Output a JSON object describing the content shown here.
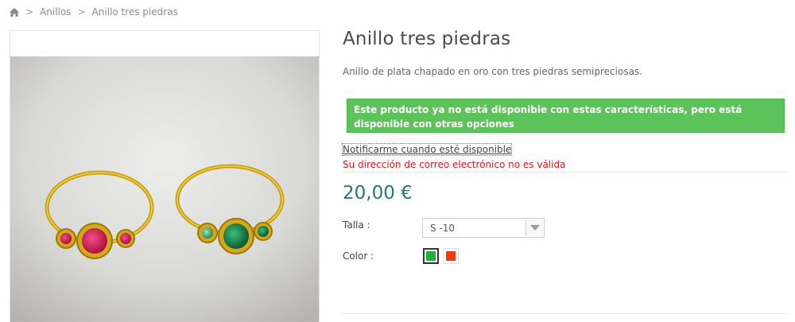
{
  "breadcrumb": {
    "home_icon": "home-icon",
    "separator": ">",
    "items": [
      "Anillos",
      "Anillo tres piedras"
    ]
  },
  "product": {
    "title": "Anillo tres piedras",
    "description": "Anillo de plata chapado en oro con tres piedras semipreciosas.",
    "availability_alert": "Este producto ya no está disponible con estas características, pero está disponible con otras opciones",
    "notify_link": "Notificarme cuando esté disponible",
    "email_error": "Su dirección de correo electrónico no es válida",
    "price": "20,00 €"
  },
  "variants": {
    "size_label": "Talla :",
    "size_value": "S -10",
    "color_label": "Color :",
    "colors": [
      {
        "name": "green",
        "hex": "#1db33a",
        "selected": true
      },
      {
        "name": "red",
        "hex": "#f33a12",
        "selected": false
      }
    ]
  },
  "colors": {
    "alert_bg": "#5cc25a",
    "price": "#1f7a7a",
    "error": "#e4141b"
  }
}
